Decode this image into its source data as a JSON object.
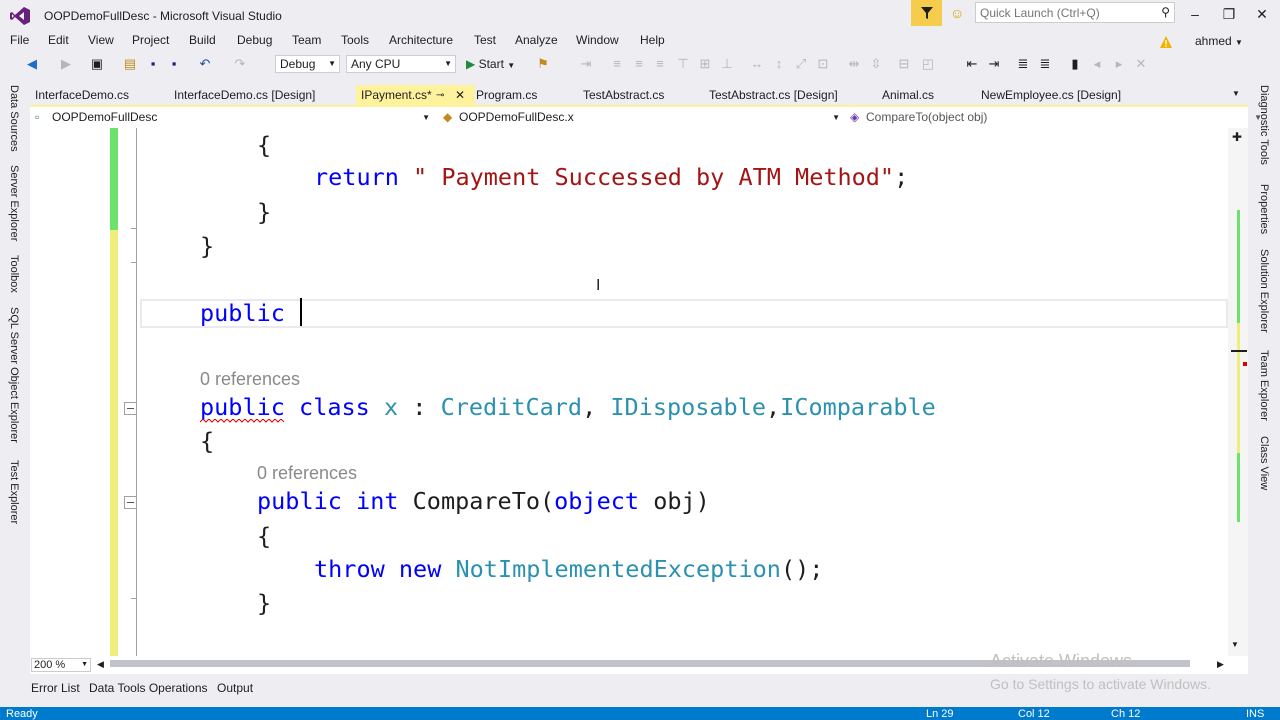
{
  "window": {
    "title": "OOPDemoFullDesc - Microsoft Visual Studio",
    "quick_launch_placeholder": "Quick Launch (Ctrl+Q)"
  },
  "menu": [
    "File",
    "Edit",
    "View",
    "Project",
    "Build",
    "Debug",
    "Team",
    "Tools",
    "Architecture",
    "Test",
    "Analyze",
    "Window",
    "Help"
  ],
  "user": "ahmed",
  "toolbar": {
    "config": "Debug",
    "platform": "Any CPU",
    "start_label": "Start"
  },
  "left_tool_windows": [
    "Data Sources",
    "Server Explorer",
    "Toolbox",
    "SQL Server Object Explorer",
    "Test Explorer"
  ],
  "right_tool_windows": [
    "Diagnostic Tools",
    "Properties",
    "Solution Explorer",
    "Team Explorer",
    "Class View"
  ],
  "tabs": [
    {
      "label": "InterfaceDemo.cs"
    },
    {
      "label": "InterfaceDemo.cs [Design]"
    },
    {
      "label": "IPayment.cs*",
      "active": true
    },
    {
      "label": "Program.cs"
    },
    {
      "label": "TestAbstract.cs"
    },
    {
      "label": "TestAbstract.cs [Design]"
    },
    {
      "label": "Animal.cs"
    },
    {
      "label": "NewEmployee.cs [Design]"
    }
  ],
  "navbar": {
    "project": "OOPDemoFullDesc",
    "type": "OOPDemoFullDesc.x",
    "member": "CompareTo(object obj)"
  },
  "code": {
    "l1": "{",
    "l2_kw": "return",
    "l2_str": "\" Payment Successed by ATM Method\"",
    "l2_end": ";",
    "l3": "}",
    "l4": "}",
    "l5_kw": "public",
    "refs1": "0 references",
    "l6_kw1": "public",
    "l6_kw2": "class",
    "l6_name": "x",
    "l6_colon": ":",
    "l6_t1": "CreditCard",
    "l6_comma1": ",",
    "l6_t2": "IDisposable",
    "l6_comma2": ",",
    "l6_t3": "IComparable",
    "l7": "{",
    "refs2": "0 references",
    "l8_kw1": "public",
    "l8_kw2": "int",
    "l8_name": "CompareTo(",
    "l8_kw3": "object",
    "l8_param": "obj)",
    "l9": "{",
    "l10_kw1": "throw",
    "l10_kw2": "new",
    "l10_type": "NotImplementedException",
    "l10_end": "();",
    "l11": "}"
  },
  "zoom": "200 %",
  "bottom_tabs": [
    "Error List",
    "Data Tools Operations",
    "Output"
  ],
  "watermark": {
    "line1": "Activate Windows",
    "line2": "Go to Settings to activate Windows."
  },
  "status": {
    "ready": "Ready",
    "ln": "Ln 29",
    "col": "Col 12",
    "ch": "Ch 12",
    "mode": "INS"
  },
  "colors": {
    "status_bar": "#007acc",
    "active_tab": "#fff29d",
    "keyword": "#0000ff",
    "type": "#2b91af",
    "string": "#a31515"
  }
}
